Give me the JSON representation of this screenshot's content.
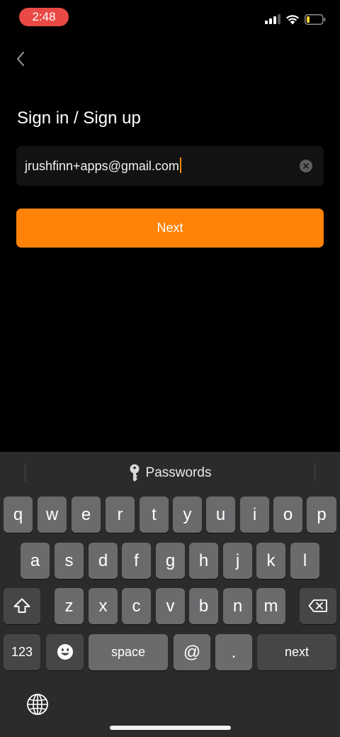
{
  "status_bar": {
    "time": "2:48"
  },
  "screen": {
    "title": "Sign in / Sign up",
    "email_value": "jrushfinn+apps@gmail.com",
    "next_label": "Next"
  },
  "keyboard": {
    "suggestion": "Passwords",
    "row1": [
      "q",
      "w",
      "e",
      "r",
      "t",
      "y",
      "u",
      "i",
      "o",
      "p"
    ],
    "row2": [
      "a",
      "s",
      "d",
      "f",
      "g",
      "h",
      "j",
      "k",
      "l"
    ],
    "row3": [
      "z",
      "x",
      "c",
      "v",
      "b",
      "n",
      "m"
    ],
    "numbers_label": "123",
    "space_label": "space",
    "at_label": "@",
    "dot_label": ".",
    "return_label": "next"
  },
  "colors": {
    "accent": "#ff8308",
    "time_pill": "#ea4a45",
    "caret": "#ff8a00",
    "battery_low": "#f7d038"
  },
  "icons": {
    "back": "chevron-left-icon",
    "clear": "clear-circle-icon",
    "key": "key-icon",
    "shift": "shift-icon",
    "delete": "backspace-icon",
    "emoji": "emoji-icon",
    "globe": "globe-icon",
    "signal": "signal-bars-icon",
    "wifi": "wifi-icon",
    "battery": "battery-icon"
  }
}
